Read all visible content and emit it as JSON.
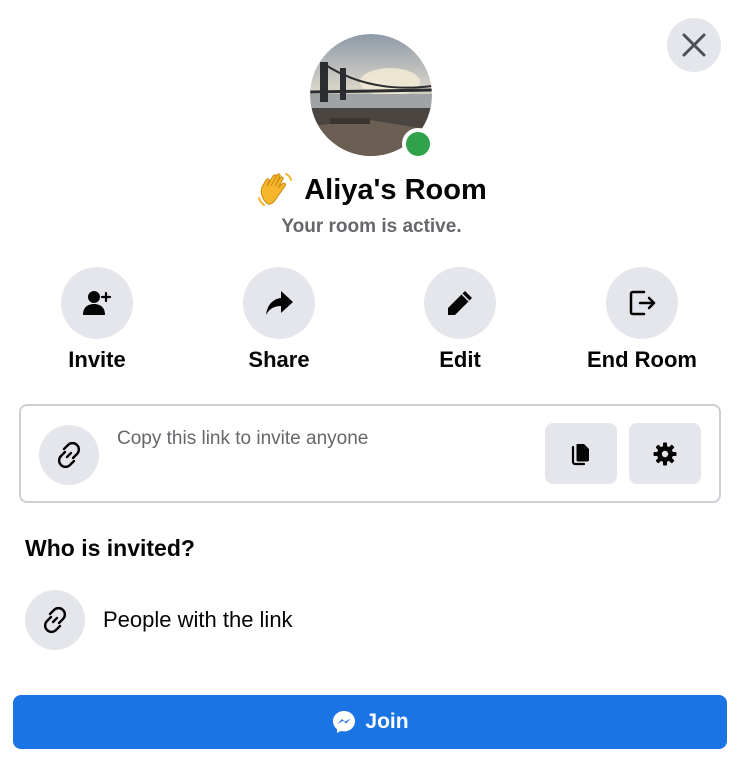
{
  "room": {
    "title": "Aliya's Room",
    "subtitle": "Your room is active.",
    "status": "active"
  },
  "actions": [
    {
      "label": "Invite",
      "icon": "add-person-icon"
    },
    {
      "label": "Share",
      "icon": "share-arrow-icon"
    },
    {
      "label": "Edit",
      "icon": "pencil-icon"
    },
    {
      "label": "End Room",
      "icon": "exit-icon"
    }
  ],
  "link_box": {
    "prompt": "Copy this link to invite anyone",
    "url": "",
    "copy_icon": "copy-icon",
    "settings_icon": "gear-icon"
  },
  "invited": {
    "heading": "Who is invited?",
    "option": "People with the link",
    "icon": "link-icon"
  },
  "join": {
    "label": "Join",
    "icon": "messenger-icon"
  },
  "colors": {
    "accent": "#1b74e4",
    "status_online": "#31a24c",
    "icon_bg": "#e4e6eb",
    "secondary_text": "#65676b"
  }
}
